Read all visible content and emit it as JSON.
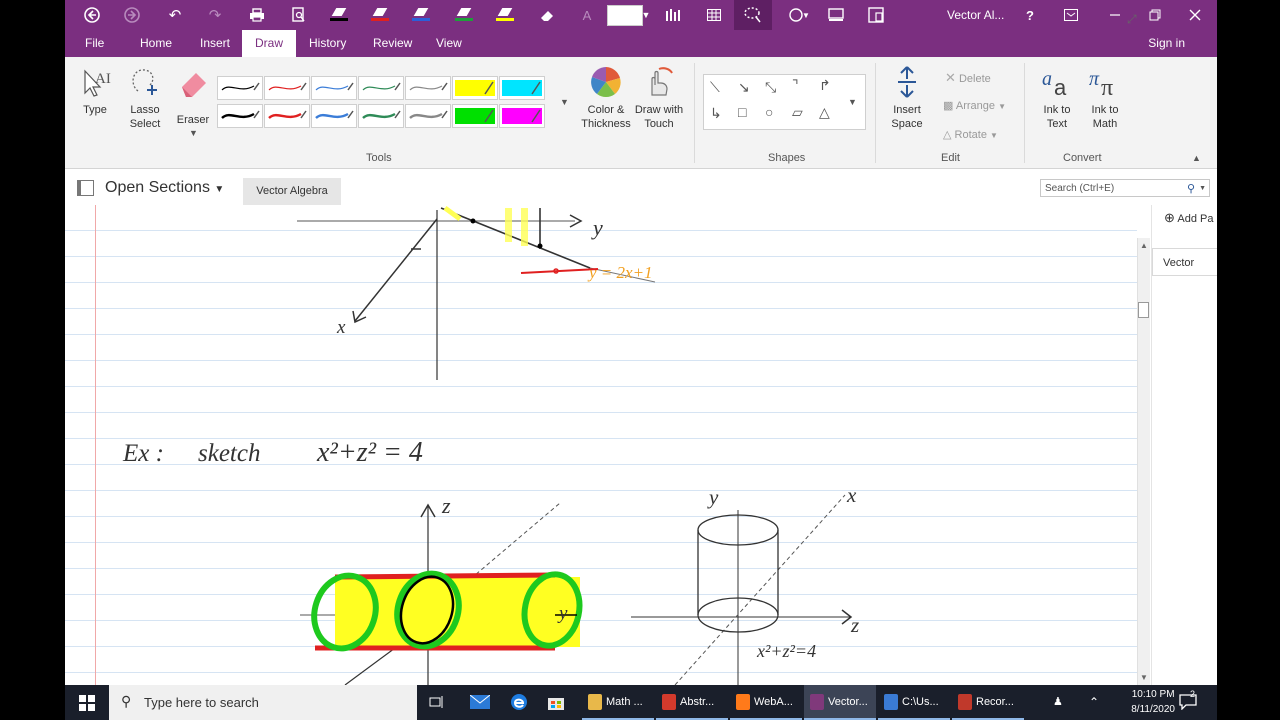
{
  "titlebar": {
    "title": "Vector Al...",
    "help": "?",
    "colors": {
      "bar": "#7b2f80"
    },
    "pens": [
      {
        "name": "black-pen",
        "color": "#000000"
      },
      {
        "name": "red-pen",
        "color": "#e02020"
      },
      {
        "name": "blue-pen",
        "color": "#2b5fd9"
      },
      {
        "name": "green-pen",
        "color": "#1e9e3a"
      },
      {
        "name": "yellow-highlighter",
        "color": "#ffff00"
      }
    ]
  },
  "menu": {
    "tabs": [
      "File",
      "Home",
      "Insert",
      "Draw",
      "History",
      "Review",
      "View"
    ],
    "active": "Draw",
    "sign_in": "Sign in"
  },
  "ribbon": {
    "type": "Type",
    "lasso_select": [
      "Lasso",
      "Select"
    ],
    "eraser": "Eraser",
    "color_thickness": [
      "Color &",
      "Thickness"
    ],
    "draw_with_touch": [
      "Draw with",
      "Touch"
    ],
    "insert_space": [
      "Insert",
      "Space"
    ],
    "delete": "Delete",
    "arrange": "Arrange",
    "rotate": "Rotate",
    "ink_to_text": [
      "Ink to",
      "Text"
    ],
    "ink_to_math": [
      "Ink to",
      "Math"
    ],
    "groups": {
      "tools": "Tools",
      "shapes": "Shapes",
      "edit": "Edit",
      "convert": "Convert"
    },
    "pen_swatches": [
      "#000000",
      "#e02020",
      "#3b7dd8",
      "#2e8b57",
      "#888888",
      "#ffff00",
      "#00e5ff",
      "#000000",
      "#e02020",
      "#3b7dd8",
      "#2e8b57",
      "#888888",
      "#00e000",
      "#ff00ff"
    ]
  },
  "section_bar": {
    "open_sections": "Open Sections",
    "section_tab": "Vector Algebra",
    "search_placeholder": "Search (Ctrl+E)"
  },
  "page_panel": {
    "add_page": "Add Pa",
    "page_tab": "Vector"
  },
  "canvas": {
    "y_axis_label": "y",
    "x_axis_label": "x",
    "line_label": "y = 2x+1",
    "example_label": "Ex :",
    "sketch_word": "sketch",
    "equation": "x²+z² = 4",
    "z_label": "z",
    "y_label2": "y",
    "right_y_label": "y",
    "right_x_label": "x",
    "right_z_label": "z",
    "circle_label": "x²+z²=4"
  },
  "taskbar": {
    "search_text": "Type here to search",
    "apps": [
      {
        "label": "Math ...",
        "icon_color": "#e8b84a",
        "name": "taskbar-math-folder"
      },
      {
        "label": "Abstr...",
        "icon_color": "#d33a2c",
        "name": "taskbar-abstract-pdf"
      },
      {
        "label": "WebA...",
        "icon_color": "#ff7a1a",
        "name": "taskbar-firefox"
      },
      {
        "label": "Vector...",
        "icon_color": "#80397b",
        "name": "taskbar-onenote"
      },
      {
        "label": "C:\\Us...",
        "icon_color": "#3a7bd5",
        "name": "taskbar-explorer"
      },
      {
        "label": "Recor...",
        "icon_color": "#c0392b",
        "name": "taskbar-recorder"
      }
    ],
    "time": "10:10 PM",
    "date": "8/11/2020",
    "notification_count": "2"
  }
}
